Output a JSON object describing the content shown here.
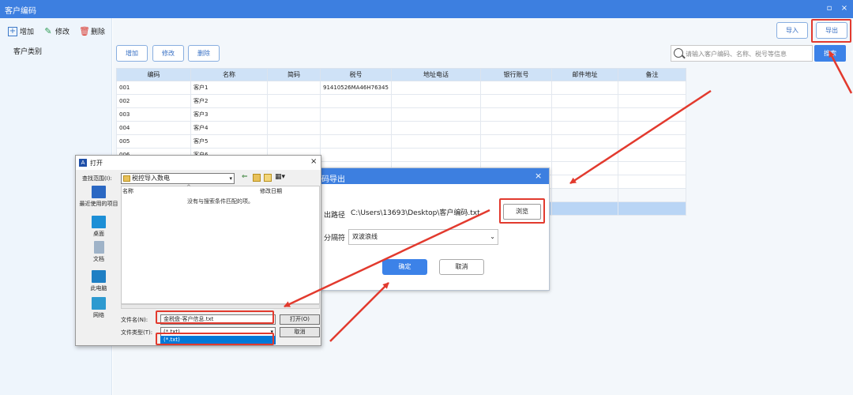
{
  "window": {
    "title": "客户编码",
    "btn_min": "▫",
    "btn_close": "×"
  },
  "sidebar": {
    "add": "增加",
    "edit": "修改",
    "del": "删除",
    "category": "客户类别"
  },
  "toolbar": {
    "add": "增加",
    "edit": "修改",
    "del": "删除",
    "import": "导入",
    "export": "导出"
  },
  "search": {
    "placeholder": "请输入客户编码、名称、税号等信息",
    "button": "搜索"
  },
  "table": {
    "headers": [
      "编码",
      "名称",
      "简码",
      "税号",
      "地址电话",
      "银行账号",
      "邮件地址",
      "备注"
    ],
    "rows": [
      [
        "001",
        "客户1",
        "",
        "91410526MA46H76345",
        "",
        "",
        "",
        ""
      ],
      [
        "002",
        "客户2",
        "",
        "",
        "",
        "",
        "",
        ""
      ],
      [
        "003",
        "客户3",
        "",
        "",
        "",
        "",
        "",
        ""
      ],
      [
        "004",
        "客户4",
        "",
        "",
        "",
        "",
        "",
        ""
      ],
      [
        "005",
        "客户5",
        "",
        "",
        "",
        "",
        "",
        ""
      ],
      [
        "006",
        "客户6",
        "",
        "",
        "",
        "",
        "",
        ""
      ]
    ]
  },
  "export_dialog": {
    "title": "码导出",
    "close": "×",
    "path_label": "出路径",
    "path_value": "C:\\Users\\13693\\Desktop\\客户编码.txt",
    "browse": "浏览",
    "sep_label": "分隔符",
    "sep_value": "双波浪线",
    "ok": "确定",
    "cancel": "取消"
  },
  "open_dialog": {
    "title": "打开",
    "close": "×",
    "lookin_label": "查找范围(I):",
    "lookin_value": "税控导入数电",
    "places": [
      "最近使用的项目",
      "桌面",
      "文档",
      "此电脑",
      "网络"
    ],
    "col_name": "名称",
    "col_date": "修改日期",
    "empty_msg": "没有与搜索条件匹配的项。",
    "filename_label": "文件名(N):",
    "filename_value": "金税盘-客户信息.txt",
    "filetype_label": "文件类型(T):",
    "filetype_value": "(*.txt)",
    "dropdown_option": "(*.txt)",
    "open_btn": "打开(O)",
    "cancel_btn": "取消"
  },
  "colors": {
    "accent": "#3d7fe0",
    "annotation": "#e23a2e"
  }
}
